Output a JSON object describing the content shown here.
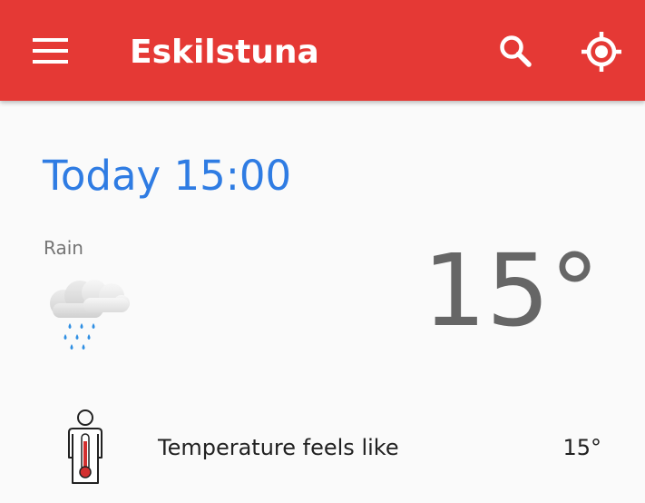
{
  "app_bar": {
    "title": "Eskilstuna",
    "background_color": "#e53935",
    "icons": {
      "menu": "menu-icon",
      "search": "search-icon",
      "location": "my-location-icon"
    }
  },
  "forecast": {
    "datetime": "Today 15:00",
    "condition": "Rain",
    "condition_icon": "rain-cloud-icon",
    "temperature": "15°",
    "accent_color": "#2f7ce3"
  },
  "details": [
    {
      "label": "Temperature feels like",
      "value": "15°",
      "icon": "thermometer-person-icon"
    }
  ]
}
